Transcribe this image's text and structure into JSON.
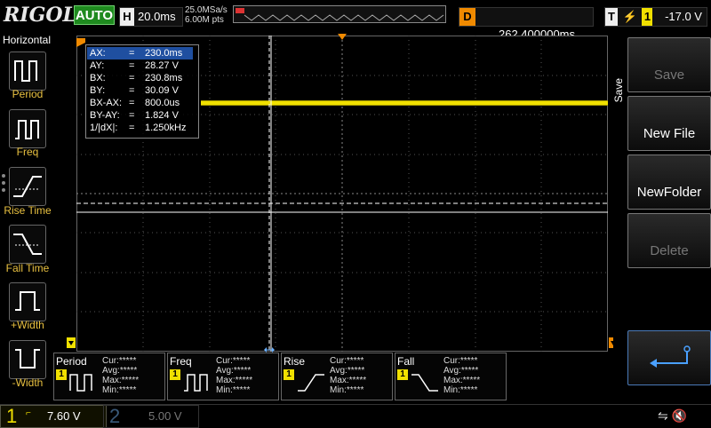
{
  "brand": {
    "name": "RIGOL"
  },
  "top": {
    "run_mode": "AUTO",
    "timebase": {
      "label": "H",
      "value": "20.0ms"
    },
    "sample_rate": "25.0MSa/s",
    "memory_depth": "6.00M pts",
    "delay": {
      "label": "D",
      "value": "262.400000ms"
    },
    "trigger": {
      "label": "T",
      "source": "1",
      "level": "-17.0 V"
    }
  },
  "left_panel": {
    "title": "Horizontal",
    "items": [
      {
        "label": "Period",
        "icon": "period-icon"
      },
      {
        "label": "Freq",
        "icon": "freq-icon"
      },
      {
        "label": "Rise Time",
        "icon": "rise-time-icon"
      },
      {
        "label": "Fall Time",
        "icon": "fall-time-icon"
      },
      {
        "label": "+Width",
        "icon": "pos-width-icon"
      },
      {
        "label": "-Width",
        "icon": "neg-width-icon"
      }
    ]
  },
  "cursor": {
    "rows": [
      {
        "k": "AX:",
        "v": "230.0ms"
      },
      {
        "k": "AY:",
        "v": "28.27 V"
      },
      {
        "k": "BX:",
        "v": "230.8ms"
      },
      {
        "k": "BY:",
        "v": "30.09 V"
      },
      {
        "k": "BX-AX:",
        "v": "800.0us"
      },
      {
        "k": "BY-AY:",
        "v": "1.824 V"
      },
      {
        "k": "1/|dX|:",
        "v": "1.250kHz"
      }
    ],
    "eq": "="
  },
  "right_menu": {
    "title": "Save",
    "keys": [
      {
        "label": "Save",
        "enabled": false
      },
      {
        "label": "New File",
        "enabled": true
      },
      {
        "label": "NewFolder",
        "enabled": true
      },
      {
        "label": "Delete",
        "enabled": false
      },
      {
        "label": "",
        "icon": "enter-icon"
      }
    ]
  },
  "results": [
    {
      "title": "Period",
      "ch": "1",
      "cur": "Cur:*****",
      "avg": "Avg:*****",
      "max": "Max:*****",
      "min": "Min:*****"
    },
    {
      "title": "Freq",
      "ch": "1",
      "cur": "Cur:*****",
      "avg": "Avg:*****",
      "max": "Max:*****",
      "min": "Min:*****"
    },
    {
      "title": "Rise",
      "ch": "1",
      "cur": "Cur:*****",
      "avg": "Avg:*****",
      "max": "Max:*****",
      "min": "Min:*****"
    },
    {
      "title": "Fall",
      "ch": "1",
      "cur": "Cur:*****",
      "avg": "Avg:*****",
      "max": "Max:*****",
      "min": "Min:*****"
    }
  ],
  "channels": [
    {
      "num": "1",
      "scale": "7.60 V",
      "color": "#f0e000"
    },
    {
      "num": "2",
      "scale": "5.00 V",
      "color": "#3a5a7a"
    }
  ],
  "colors": {
    "trace": "#f0e000",
    "grid": "#555555",
    "cursor_line": "#ffffff",
    "marker": "#f08a00"
  }
}
